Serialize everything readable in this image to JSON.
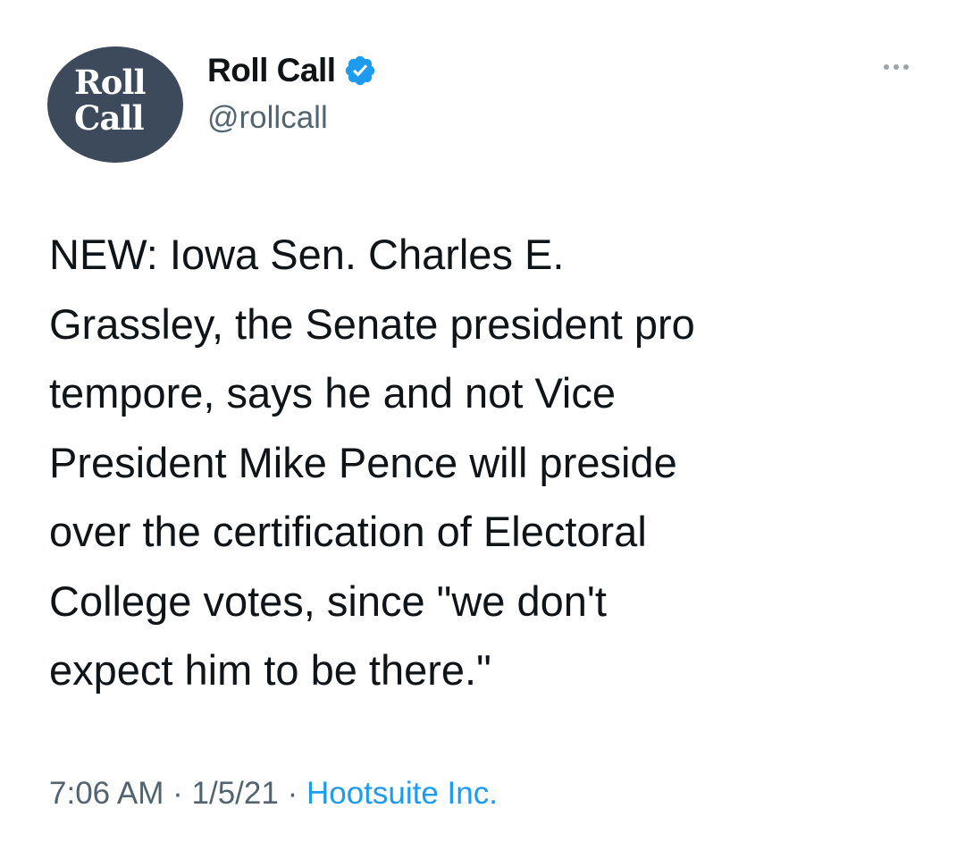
{
  "account": {
    "avatar_line1": "Roll",
    "avatar_line2": "Call",
    "display_name": "Roll Call",
    "handle": "@rollcall",
    "verified_icon": "verified-badge-icon",
    "verified_color": "#1d9bf0"
  },
  "more_icon": "more-options-icon",
  "tweet": {
    "lines": [
      "NEW: Iowa Sen. Charles E.",
      "Grassley, the Senate president pro",
      "tempore, says he and not Vice",
      "President Mike Pence will preside",
      "over the certification of Electoral",
      "College votes, since \"we don't",
      "expect him to be there.\""
    ]
  },
  "meta": {
    "time": "7:06 AM",
    "separator": " · ",
    "date": "1/5/21",
    "source": "Hootsuite Inc."
  },
  "colors": {
    "text": "#0f1419",
    "secondary": "#536471",
    "accent": "#1d9bf0",
    "avatar_bg": "#3c4a5b"
  }
}
